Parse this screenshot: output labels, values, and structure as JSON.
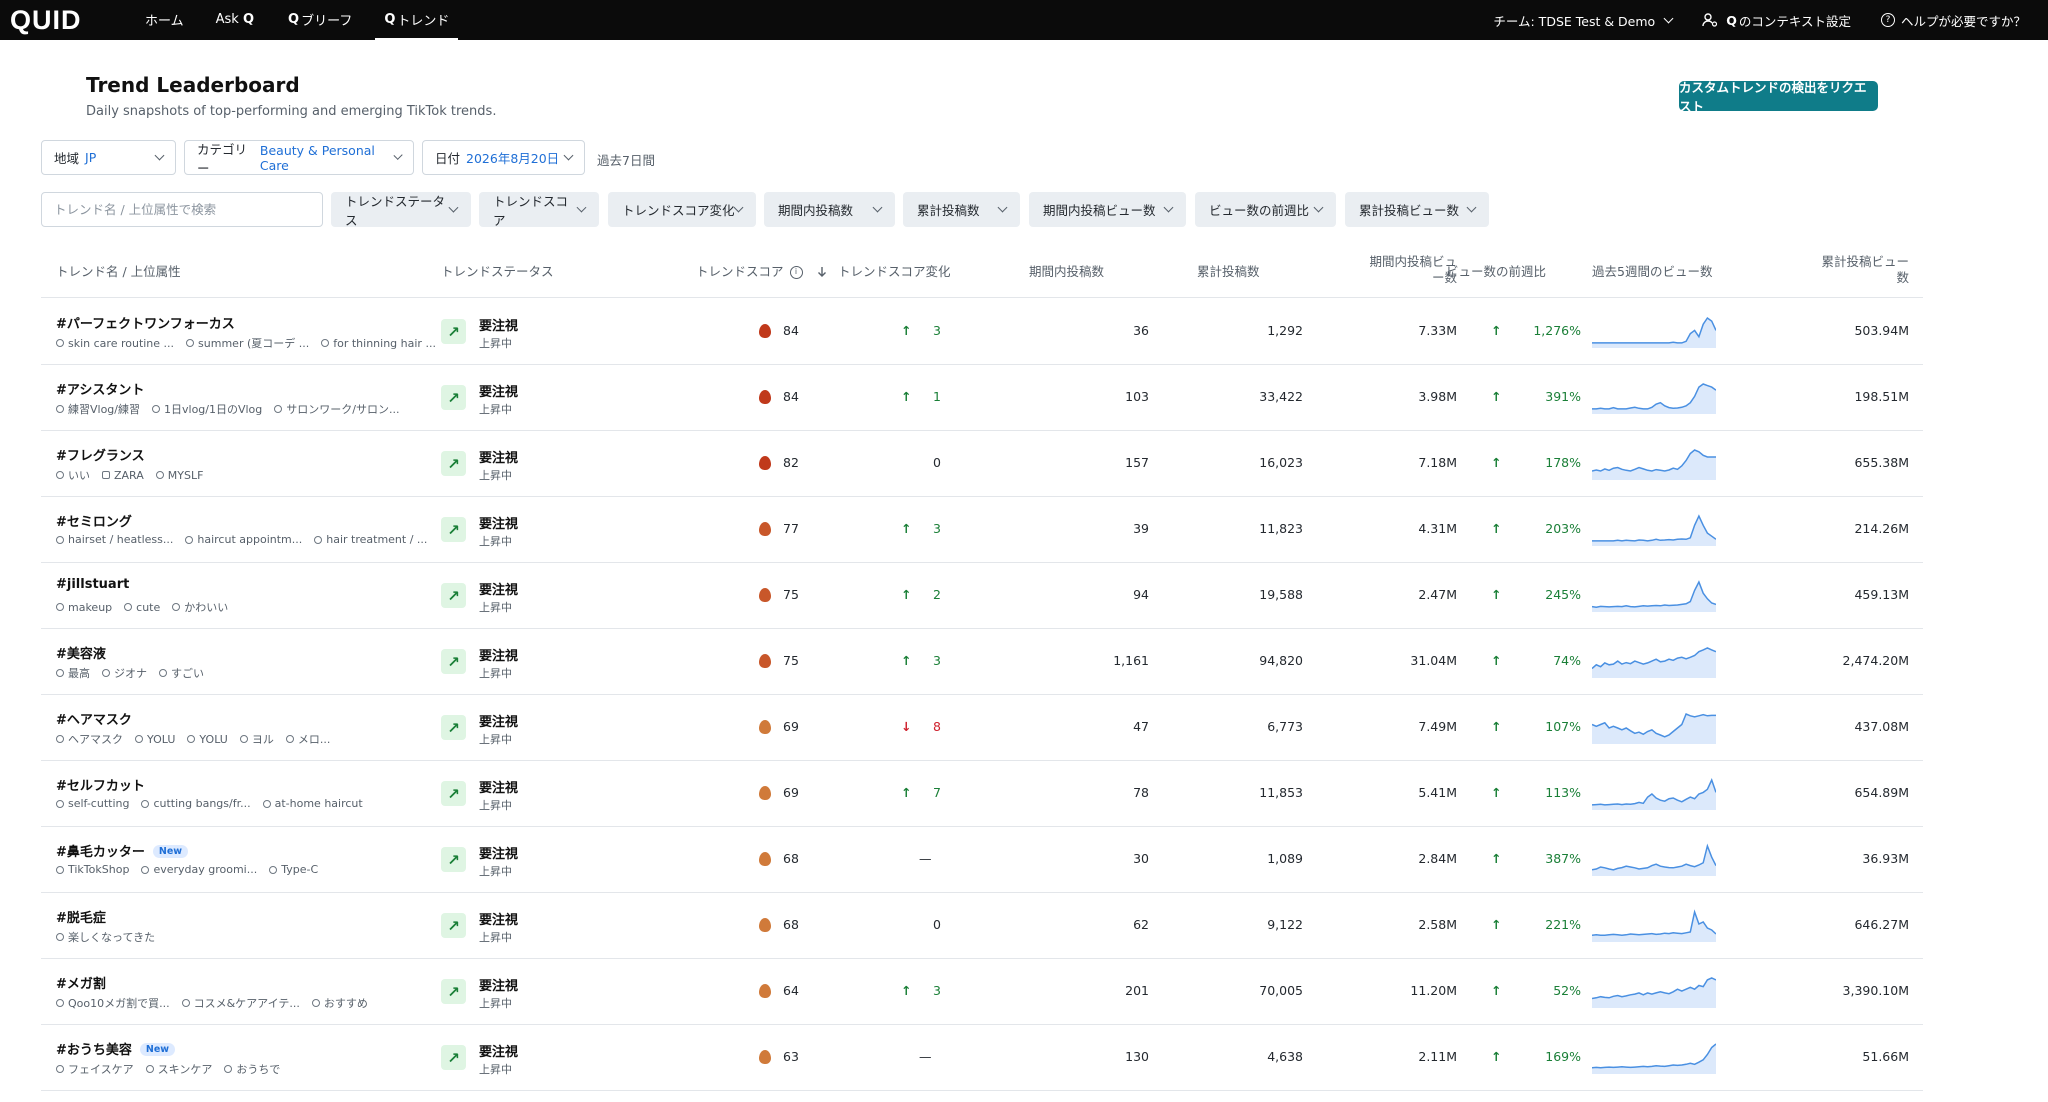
{
  "nav": {
    "logo": "QUID",
    "items": [
      {
        "label": "ホーム",
        "q": ""
      },
      {
        "label": "Ask",
        "q": "Q",
        "suffix": true
      },
      {
        "label": "ブリーフ",
        "q": "Q"
      },
      {
        "label": "トレンド",
        "q": "Q"
      }
    ],
    "team": "チーム: TDSE Test & Demo",
    "context": "のコンテキスト設定",
    "context_q": "Q",
    "help": "ヘルプが必要ですか？"
  },
  "header": {
    "title": "Trend Leaderboard",
    "subtitle": "Daily snapshots of top-performing and emerging TikTok trends.",
    "cta": "カスタムトレンドの検出をリクエスト"
  },
  "filters": {
    "region_label": "地域",
    "region_value": "JP",
    "category_label": "カテゴリー",
    "category_value": "Beauty & Personal Care",
    "date_label": "日付",
    "date_value": "2026年8月20日",
    "period": "過去7日間",
    "search_placeholder": "トレンド名 / 上位属性で検索",
    "chips": [
      "トレンドステータス",
      "トレンドスコア",
      "トレンドスコア変化",
      "期間内投稿数",
      "累計投稿数",
      "期間内投稿ビュー数",
      "ビュー数の前週比",
      "累計投稿ビュー数"
    ]
  },
  "columns": {
    "name": "トレンド名 / 上位属性",
    "status": "トレンドステータス",
    "score": "トレンドスコア",
    "score_change": "トレンドスコア変化",
    "posts_period": "期間内投稿数",
    "posts_total": "累計投稿数",
    "views_period_l1": "期間内投稿ビュ",
    "views_period_l2": "ー数",
    "wow": "ビュー数の前週比",
    "spark": "過去5週間のビュー数",
    "views_total_l1": "累計投稿ビュー",
    "views_total_l2": "数"
  },
  "icons": {
    "info": "info-icon",
    "sort": "sort-down-arrow-icon",
    "status": "trend-up-arrow-icon",
    "flame": "flame-icon"
  },
  "colors": {
    "accent": "#0f7c89",
    "link": "#1f6fd6",
    "positive": "#1a7f37",
    "negative": "#cf222e",
    "spark": "#4a90e2"
  },
  "rows": [
    {
      "name": "#パーフェクトワンフォーカス",
      "new": false,
      "attrs": [
        "skin care routine ...",
        "summer (夏コーデ ...",
        "for thinning hair ..."
      ],
      "status": "要注視",
      "status_sub": "上昇中",
      "flame": "#c0391b",
      "score": "84",
      "change_dir": "up",
      "change": "3",
      "posts_period": "36",
      "posts_total": "1,292",
      "views_period": "7.33M",
      "wow": "1,276%",
      "views_total": "503.94M",
      "spark": [
        1,
        1,
        1,
        1,
        1,
        1,
        1,
        1,
        1,
        1,
        1,
        1,
        1,
        1,
        1,
        1,
        1,
        1,
        1,
        1.2,
        1,
        1,
        1.5,
        4,
        5,
        3,
        7,
        9,
        8,
        5
      ]
    },
    {
      "name": "#アシスタント",
      "new": false,
      "attrs": [
        "練習Vlog/練習",
        "1日vlog/1日のVlog",
        "サロンワーク/サロン..."
      ],
      "status": "要注視",
      "status_sub": "上昇中",
      "flame": "#c0391b",
      "score": "84",
      "change_dir": "up",
      "change": "1",
      "posts_period": "103",
      "posts_total": "33,422",
      "views_period": "3.98M",
      "wow": "391%",
      "views_total": "198.51M",
      "spark": [
        1,
        1,
        1.2,
        1,
        1,
        1.4,
        1,
        1,
        1,
        1.3,
        1.5,
        1.2,
        1,
        1,
        1.5,
        2.5,
        3,
        2,
        1.4,
        1.2,
        1.3,
        1.5,
        2,
        3,
        5,
        8,
        9,
        8.5,
        8,
        7
      ]
    },
    {
      "name": "#フレグランス",
      "new": false,
      "attrs": [
        "いい",
        "ZARA",
        "MYSLF"
      ],
      "status": "要注視",
      "status_sub": "上昇中",
      "flame": "#c0391b",
      "score": "82",
      "change_dir": "none",
      "change": "0",
      "posts_period": "157",
      "posts_total": "16,023",
      "views_period": "7.18M",
      "wow": "178%",
      "views_total": "655.38M",
      "spark": [
        2,
        2.3,
        2,
        2.6,
        2.2,
        2.8,
        3,
        2.5,
        2.2,
        2,
        2.5,
        3,
        2.6,
        2.2,
        2,
        2.4,
        2.2,
        2,
        2.3,
        2.8,
        2.5,
        3.5,
        5,
        7,
        8,
        7.5,
        6.5,
        6,
        6,
        6
      ]
    },
    {
      "name": "#セミロング",
      "new": false,
      "attrs": [
        "hairset / heatless...",
        "haircut appointm...",
        "hair treatment / ..."
      ],
      "status": "要注視",
      "status_sub": "上昇中",
      "flame": "#c8572a",
      "score": "77",
      "change_dir": "up",
      "change": "3",
      "posts_period": "39",
      "posts_total": "11,823",
      "views_period": "4.31M",
      "wow": "203%",
      "views_total": "214.26M",
      "spark": [
        1,
        1,
        1,
        1,
        1,
        1,
        1.2,
        1,
        1.2,
        1.1,
        1,
        1.3,
        1.2,
        1,
        1.2,
        1.5,
        1.2,
        1.3,
        1.4,
        1.3,
        1.5,
        1.6,
        1.5,
        2,
        6,
        9,
        6,
        3.5,
        2.5,
        1.5
      ]
    },
    {
      "name": "#jillstuart",
      "new": false,
      "attrs": [
        "makeup",
        "cute",
        "かわいい"
      ],
      "status": "要注視",
      "status_sub": "上昇中",
      "flame": "#c8572a",
      "score": "75",
      "change_dir": "up",
      "change": "2",
      "posts_period": "94",
      "posts_total": "19,588",
      "views_period": "2.47M",
      "wow": "245%",
      "views_total": "459.13M",
      "spark": [
        1.2,
        1,
        1.3,
        1.2,
        1.1,
        1.2,
        1.3,
        1.2,
        1.5,
        1.2,
        1.1,
        1.3,
        1.5,
        1.4,
        1.5,
        1.6,
        1.5,
        1.8,
        1.6,
        1.7,
        1.8,
        2,
        2.2,
        3,
        7,
        10,
        6,
        4,
        2.5,
        2
      ]
    },
    {
      "name": "#美容液",
      "new": false,
      "attrs": [
        "最高",
        "ジオナ",
        "すごい"
      ],
      "status": "要注視",
      "status_sub": "上昇中",
      "flame": "#c8572a",
      "score": "75",
      "change_dir": "up",
      "change": "3",
      "posts_period": "1,161",
      "posts_total": "94,820",
      "views_period": "31.04M",
      "wow": "74%",
      "views_total": "2,474.20M",
      "spark": [
        2,
        3,
        2.5,
        3.5,
        3,
        3.2,
        4,
        3.2,
        3.6,
        3.3,
        4,
        3.6,
        3.2,
        3.5,
        4,
        4.5,
        3.8,
        4,
        4.5,
        4.2,
        4.8,
        5,
        4.6,
        5,
        5.5,
        6.5,
        7,
        7.5,
        7,
        6.5
      ]
    },
    {
      "name": "#ヘアマスク",
      "new": false,
      "attrs": [
        "ヘアマスク",
        "YOLU",
        "YOLU",
        "ヨル",
        "メロ..."
      ],
      "status": "要注視",
      "status_sub": "上昇中",
      "flame": "#d07a3a",
      "score": "69",
      "change_dir": "down",
      "change": "8",
      "posts_period": "47",
      "posts_total": "6,773",
      "views_period": "7.49M",
      "wow": "107%",
      "views_total": "437.08M",
      "spark": [
        5,
        4.5,
        5,
        5.5,
        4,
        4.5,
        4,
        3.5,
        4,
        3.2,
        2.5,
        2.8,
        2.2,
        3,
        3.5,
        2.5,
        2,
        1.5,
        2,
        3,
        4,
        5,
        8,
        7.5,
        7.2,
        7.5,
        7.8,
        7.5,
        7.6,
        7.6
      ]
    },
    {
      "name": "#セルフカット",
      "new": false,
      "attrs": [
        "self-cutting",
        "cutting bangs/fr...",
        "at-home haircut"
      ],
      "status": "要注視",
      "status_sub": "上昇中",
      "flame": "#d07a3a",
      "score": "69",
      "change_dir": "up",
      "change": "7",
      "posts_period": "78",
      "posts_total": "11,853",
      "views_period": "5.41M",
      "wow": "113%",
      "views_total": "654.89M",
      "spark": [
        1,
        1.1,
        1.2,
        1,
        1.1,
        1.2,
        1.3,
        1.1,
        1.3,
        1.2,
        1.4,
        1.8,
        1.5,
        3.5,
        4.5,
        3.2,
        2.5,
        2.2,
        3,
        3.2,
        2.5,
        2,
        2.8,
        3.5,
        3,
        4.5,
        5,
        6,
        9,
        5
      ]
    },
    {
      "name": "#鼻毛カッター",
      "new": true,
      "attrs": [
        "TikTokShop",
        "everyday groomi...",
        "Type-C"
      ],
      "status": "要注視",
      "status_sub": "上昇中",
      "flame": "#d07a3a",
      "score": "68",
      "change_dir": "dash",
      "change": "—",
      "posts_period": "30",
      "posts_total": "1,089",
      "views_period": "2.84M",
      "wow": "387%",
      "views_total": "36.93M",
      "spark": [
        1.5,
        1.8,
        2.5,
        2.2,
        1.8,
        1.5,
        2,
        2.3,
        2.8,
        2.5,
        2.2,
        1.8,
        2,
        2.2,
        3,
        3.5,
        2.8,
        2.5,
        2.3,
        2.2,
        2.5,
        2.8,
        3.5,
        3,
        2.6,
        3.2,
        4,
        10,
        6,
        3
      ]
    },
    {
      "name": "#脱毛症",
      "new": false,
      "attrs": [
        "楽しくなってきた"
      ],
      "status": "要注視",
      "status_sub": "上昇中",
      "flame": "#d07a3a",
      "score": "68",
      "change_dir": "none",
      "change": "0",
      "posts_period": "62",
      "posts_total": "9,122",
      "views_period": "2.58M",
      "wow": "221%",
      "views_total": "646.27M",
      "spark": [
        1.2,
        1.3,
        1.2,
        1.2,
        1.3,
        1.4,
        1.3,
        1.2,
        1.3,
        1.5,
        1.4,
        1.3,
        1.4,
        1.5,
        1.6,
        1.4,
        1.5,
        1.7,
        1.6,
        1.8,
        1.7,
        1.6,
        1.8,
        2,
        7,
        4,
        4.5,
        3,
        2.5,
        1.5
      ]
    },
    {
      "name": "#メガ割",
      "new": false,
      "attrs": [
        "Qoo10メガ割で買...",
        "コスメ&ケアアイテ...",
        "おすすめ"
      ],
      "status": "要注視",
      "status_sub": "上昇中",
      "flame": "#d07a3a",
      "score": "64",
      "change_dir": "up",
      "change": "3",
      "posts_period": "201",
      "posts_total": "70,005",
      "views_period": "11.20M",
      "wow": "52%",
      "views_total": "3,390.10M",
      "spark": [
        2,
        2.2,
        2.5,
        2.3,
        2.2,
        2.6,
        2.8,
        2.5,
        2.7,
        3,
        3.2,
        3.5,
        3,
        3.5,
        3.2,
        3.5,
        3.8,
        3.5,
        3.3,
        3.8,
        4.5,
        4,
        4.5,
        5,
        4.5,
        5.5,
        5.2,
        7,
        7.5,
        7
      ]
    },
    {
      "name": "#おうち美容",
      "new": true,
      "attrs": [
        "フェイスケア",
        "スキンケア",
        "おうちで"
      ],
      "status": "要注視",
      "status_sub": "上昇中",
      "flame": "#d07a3a",
      "score": "63",
      "change_dir": "dash",
      "change": "—",
      "posts_period": "130",
      "posts_total": "4,638",
      "views_period": "2.11M",
      "wow": "169%",
      "views_total": "51.66M",
      "spark": [
        1.2,
        1.3,
        1.2,
        1.3,
        1.4,
        1.3,
        1.4,
        1.5,
        1.4,
        1.3,
        1.4,
        1.5,
        1.6,
        1.5,
        1.6,
        1.8,
        1.7,
        1.6,
        1.8,
        2,
        1.9,
        2,
        2.2,
        2.5,
        2.2,
        2.8,
        3.5,
        5,
        7,
        8
      ]
    }
  ]
}
